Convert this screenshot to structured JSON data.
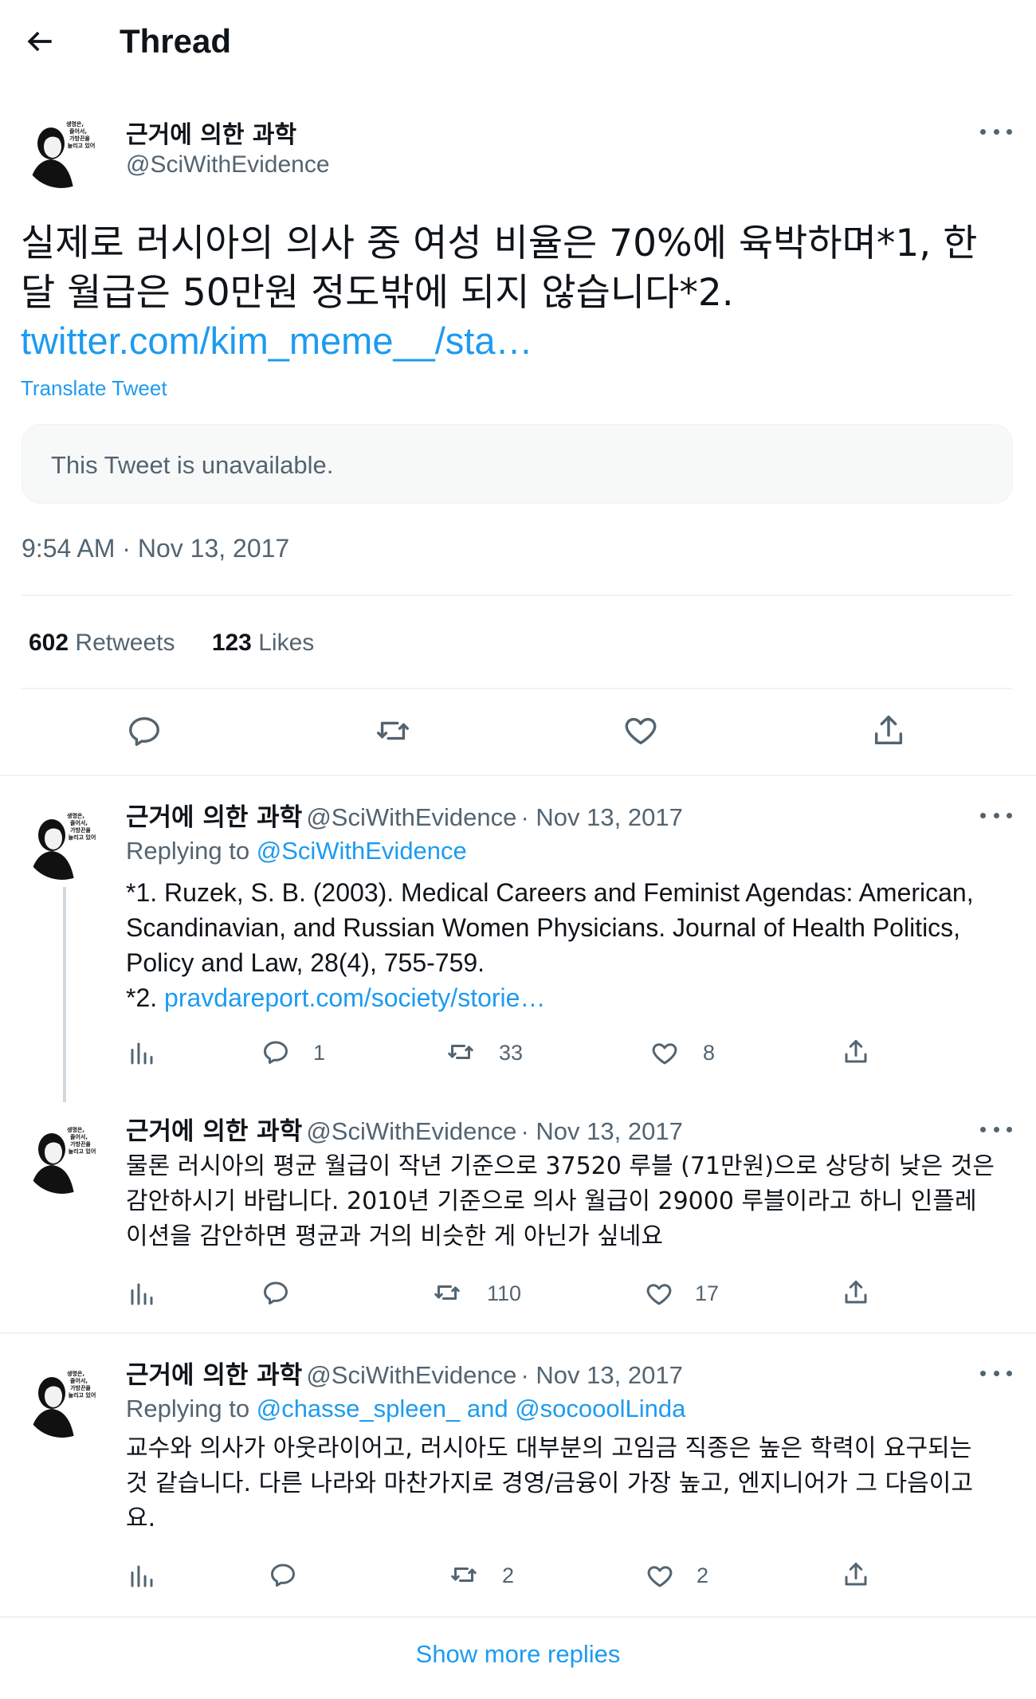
{
  "header": {
    "title": "Thread"
  },
  "main_tweet": {
    "display_name": "근거에 의한 과학",
    "handle": "@SciWithEvidence",
    "avatar_text": [
      "생명은,",
      "줄어서,",
      "가방끈을",
      "늘리고 있어"
    ],
    "text": "실제로 러시아의 의사 중 여성 비율은 70%에 육박하며*1, 한 달 월급은 50만원 정도밖에 되지 않습니다*2.",
    "link": "twitter.com/kim_meme__/sta…",
    "translate": "Translate Tweet",
    "quote_unavailable": "This Tweet is unavailable.",
    "timestamp": "9:54 AM · Nov 13, 2017",
    "retweets_count": "602",
    "retweets_label": "Retweets",
    "likes_count": "123",
    "likes_label": "Likes"
  },
  "replies": [
    {
      "display_name": "근거에 의한 과학",
      "handle": "@SciWithEvidence",
      "date": "· Nov 13, 2017",
      "replying_prefix": "Replying to",
      "replying_to": "@SciWithEvidence",
      "body_lines": [
        "*1. Ruzek, S. B. (2003). Medical Careers and Feminist Agendas: American,",
        "Scandinavian, and Russian Women Physicians. Journal of Health Politics,",
        "Policy and Law, 28(4), 755-759."
      ],
      "body_prefix": "*2.",
      "body_link": "pravdareport.com/society/storie…",
      "replies": "1",
      "retweets": "33",
      "likes": "8"
    },
    {
      "display_name": "근거에 의한 과학",
      "handle": "@SciWithEvidence",
      "date": "· Nov 13, 2017",
      "body_lines": [
        "물론 러시아의 평균 월급이 작년 기준으로 37520 루블 (71만원)으로 상당히 낮은 것은",
        "감안하시기 바랍니다. 2010년 기준으로 의사 월급이 29000 루블이라고 하니 인플레",
        "이션을 감안하면 평균과 거의 비슷한 게 아닌가 싶네요"
      ],
      "replies": "",
      "retweets": "110",
      "likes": "17"
    },
    {
      "display_name": "근거에 의한 과학",
      "handle": "@SciWithEvidence",
      "date": "· Nov 13, 2017",
      "replying_prefix": "Replying to",
      "replying_to": "@chasse_spleen_ and @socooolLinda",
      "body_lines": [
        "교수와 의사가 아웃라이어고, 러시아도 대부분의 고임금 직종은 높은 학력이 요구되는",
        "것 같습니다. 다른 나라와 마찬가지로 경영/금융이 가장 높고, 엔지니어가 그 다음이고",
        "요."
      ],
      "replies": "",
      "retweets": "2",
      "likes": "2"
    }
  ],
  "show_more": "Show more replies",
  "colors": {
    "accent": "#1d9bf0",
    "text": "#0f1419",
    "muted": "#536471",
    "divider": "#eff3f4"
  }
}
